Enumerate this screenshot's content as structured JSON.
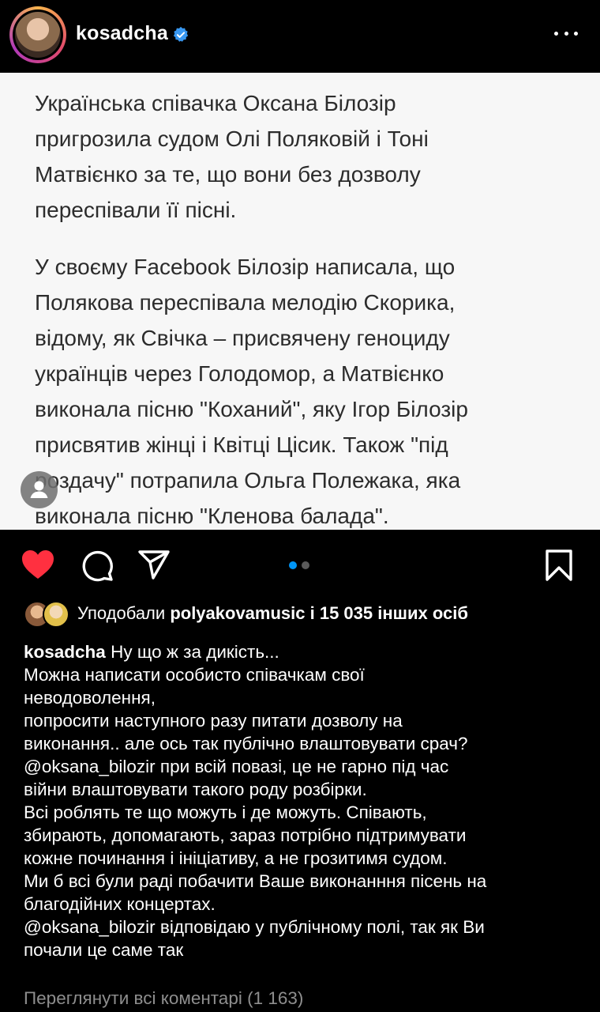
{
  "header": {
    "username": "kosadcha",
    "verified_icon": "verified-badge-icon",
    "more_icon": "more-options-icon"
  },
  "post_image": {
    "paragraph1": [
      "Українська співачка Оксана Білозір",
      "пригрозила судом Олі Поляковій і Тоні",
      "Матвієнко за те, що вони без дозволу",
      "переспівали її пісні."
    ],
    "paragraph2": [
      "У своєму Facebook Білозір написала, що",
      "Полякова переспівала мелодію Скорика,",
      "відому, як Свічка – присвячену геноциду",
      "українців через Голодомор, а Матвієнко",
      "виконала пісню \"Коханий\", яку Ігор Білозір",
      "присвятив жінці і Квітці Цісик. Також \"під",
      "роздачу\" потрапила Ольга Полежака, яка",
      "виконала пісню \"Кленова балада\"."
    ]
  },
  "actions": {
    "like_icon": "heart-filled-icon",
    "comment_icon": "comment-icon",
    "share_icon": "send-icon",
    "save_icon": "bookmark-icon",
    "carousel_dots": 2,
    "carousel_active": 1,
    "colors": {
      "heart": "#ff3040",
      "dot_active": "#0095f6",
      "dot_inactive": "#5a5a5a"
    }
  },
  "likes": {
    "prefix": "Уподобали",
    "user": "polyakovamusic",
    "suffix": "і 15 035 інших осіб"
  },
  "caption": {
    "author": "kosadcha",
    "first": "Ну що ж за дикість...",
    "lines": [
      "Можна написати особисто співачкам свої",
      "неводоволення,",
      "попросити наступного разу питати дозволу на",
      "виконання.. але ось так публічно влаштовувати срач?",
      "@oksana_bilozir при всій повазі, це не гарно під час",
      "війни влаштовувати такого роду розбірки.",
      "Всі роблять те що можуть і де можуть. Співають,",
      "збирають, допомагають, зараз потрібно підтримувати",
      "кожне починання і ініціативу, а не грозитимя судом.",
      "Ми б всі були раді побачити Ваше виконанння пісень на",
      "благодійних концертах.",
      "@oksana_bilozir відповідаю у публічному полі, так як Ви",
      "почали це саме так"
    ]
  },
  "view_comments": "Переглянути всі коментарі (1 163)"
}
